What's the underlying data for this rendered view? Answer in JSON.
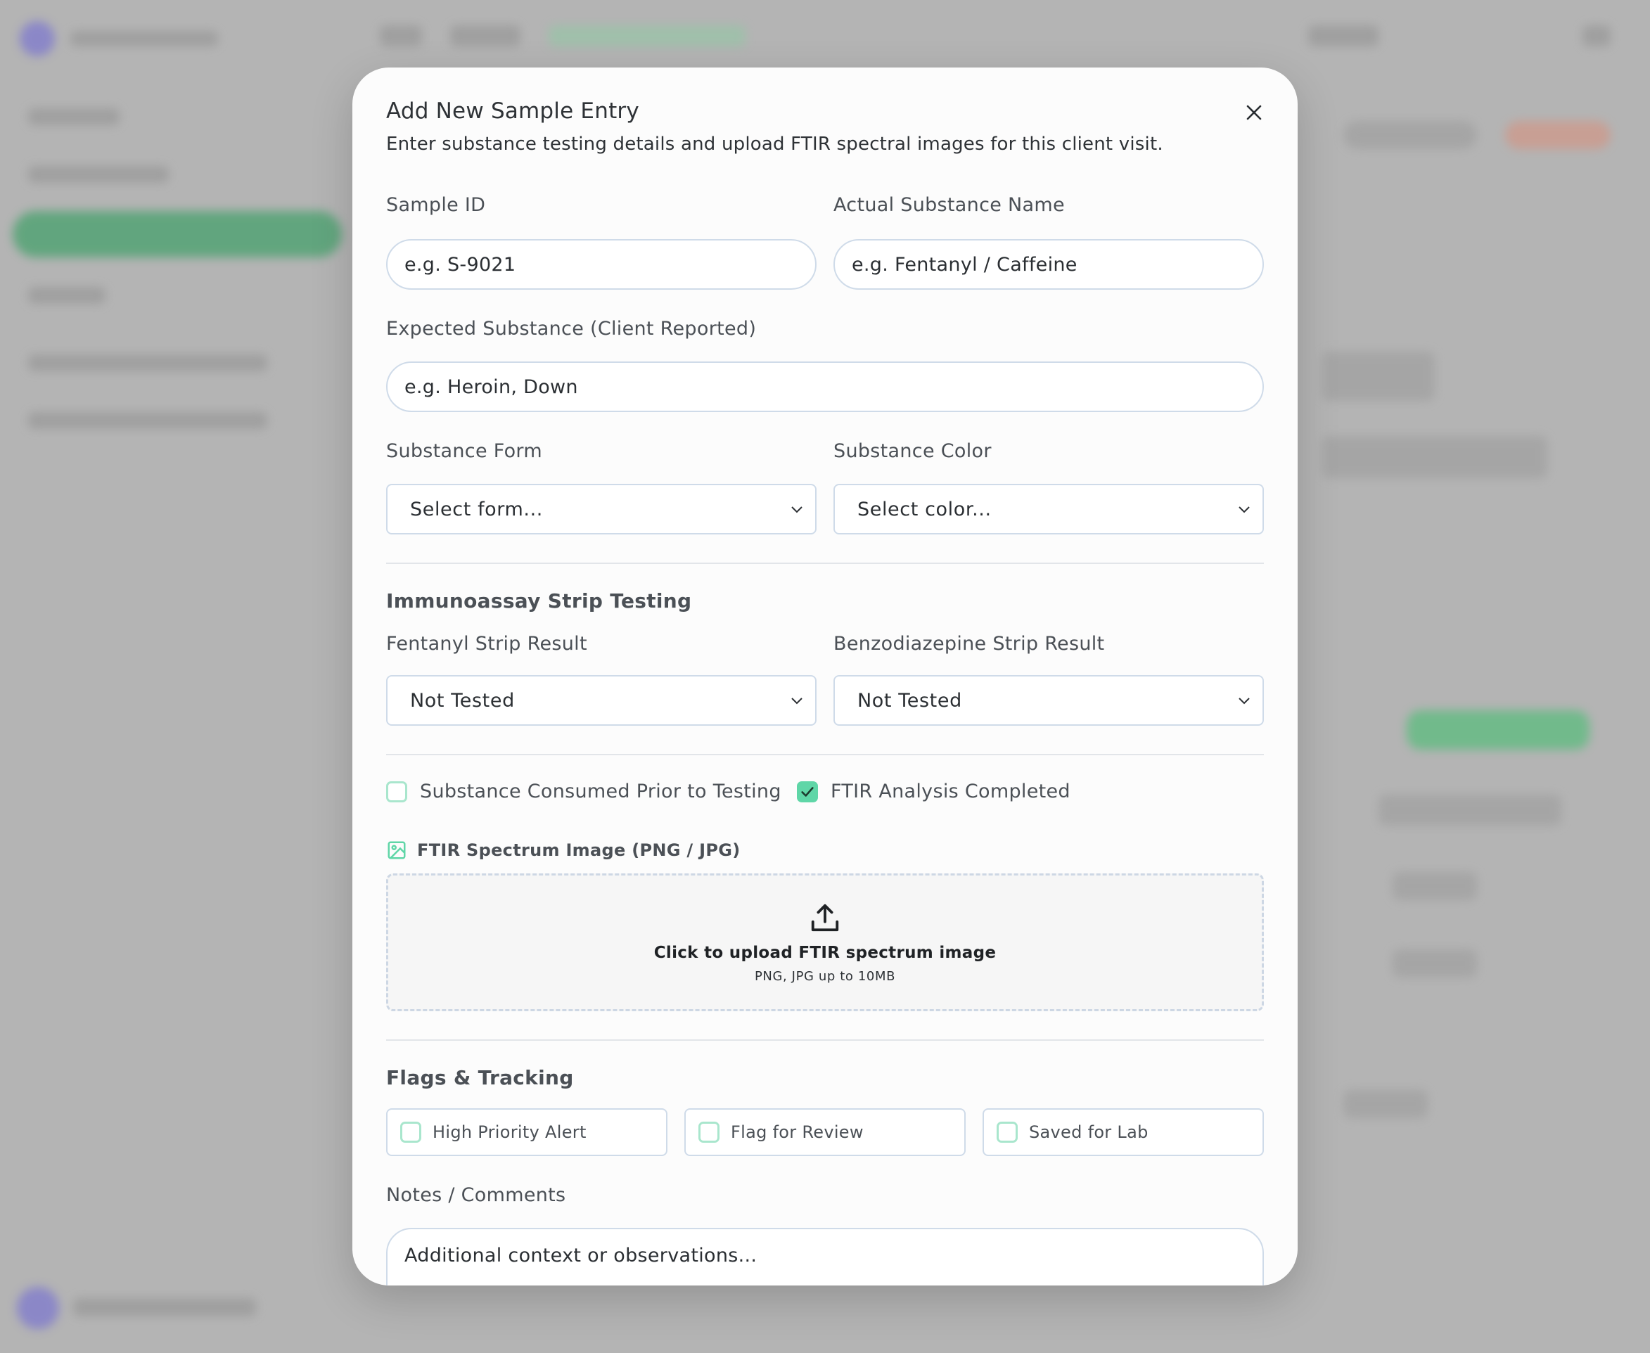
{
  "modal": {
    "title": "Add New Sample Entry",
    "subtitle": "Enter substance testing details and upload FTIR spectral images for this client visit."
  },
  "fields": {
    "sample_id": {
      "label": "Sample ID",
      "placeholder": "e.g. S-9021",
      "value": ""
    },
    "actual_substance": {
      "label": "Actual Substance Name",
      "placeholder": "e.g. Fentanyl / Caffeine",
      "value": ""
    },
    "expected_substance": {
      "label": "Expected Substance (Client Reported)",
      "placeholder": "e.g. Heroin, Down",
      "value": ""
    },
    "substance_form": {
      "label": "Substance Form",
      "selected": "Select form..."
    },
    "substance_color": {
      "label": "Substance Color",
      "selected": "Select color..."
    }
  },
  "strip_testing": {
    "title": "Immunoassay Strip Testing",
    "fentanyl": {
      "label": "Fentanyl Strip Result",
      "selected": "Not Tested"
    },
    "benzo": {
      "label": "Benzodiazepine Strip Result",
      "selected": "Not Tested"
    }
  },
  "checks": {
    "consumed": {
      "label": "Substance Consumed Prior to Testing",
      "checked": false
    },
    "ftir_completed": {
      "label": "FTIR Analysis Completed",
      "checked": true
    }
  },
  "upload": {
    "label": "FTIR Spectrum Image (PNG / JPG)",
    "prompt": "Click to upload FTIR spectrum image",
    "hint": "PNG, JPG up to 10MB"
  },
  "flags": {
    "title": "Flags & Tracking",
    "items": [
      {
        "label": "High Priority Alert",
        "checked": false
      },
      {
        "label": "Flag for Review",
        "checked": false
      },
      {
        "label": "Saved for Lab",
        "checked": false
      }
    ]
  },
  "notes": {
    "label": "Notes / Comments",
    "placeholder": "Additional context or observations..."
  },
  "colors": {
    "accent_green": "#5fd6a7",
    "checkbox_border": "#a9e6cd",
    "field_border": "#cfdbe9",
    "overlay": "#b4b4b4"
  }
}
